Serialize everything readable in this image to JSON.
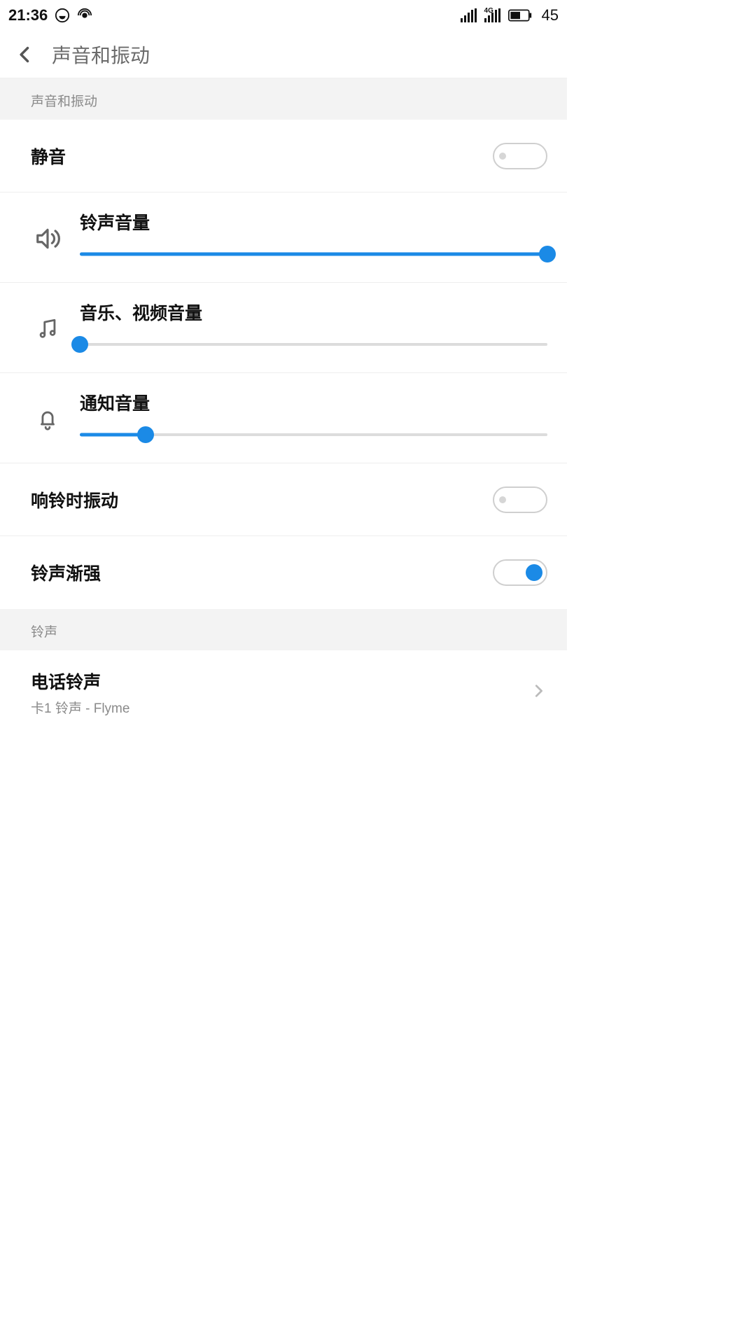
{
  "statusbar": {
    "time": "21:36",
    "battery": "45",
    "network": "4G"
  },
  "header": {
    "title": "声音和振动"
  },
  "sections": [
    {
      "label": "声音和振动"
    },
    {
      "label": "铃声"
    }
  ],
  "rows": {
    "mute": {
      "title": "静音",
      "on": false
    },
    "ring_volume": {
      "title": "铃声音量",
      "value": 100
    },
    "media_volume": {
      "title": "音乐、视频音量",
      "value": 0
    },
    "notif_volume": {
      "title": "通知音量",
      "value": 14
    },
    "vibrate_ring": {
      "title": "响铃时振动",
      "on": false
    },
    "ring_increase": {
      "title": "铃声渐强",
      "on": true
    },
    "phone_ringtone": {
      "title": "电话铃声",
      "sub": "卡1 铃声 - Flyme"
    }
  },
  "colors": {
    "accent": "#1b8ae6",
    "muted": "#8a8a8a"
  }
}
